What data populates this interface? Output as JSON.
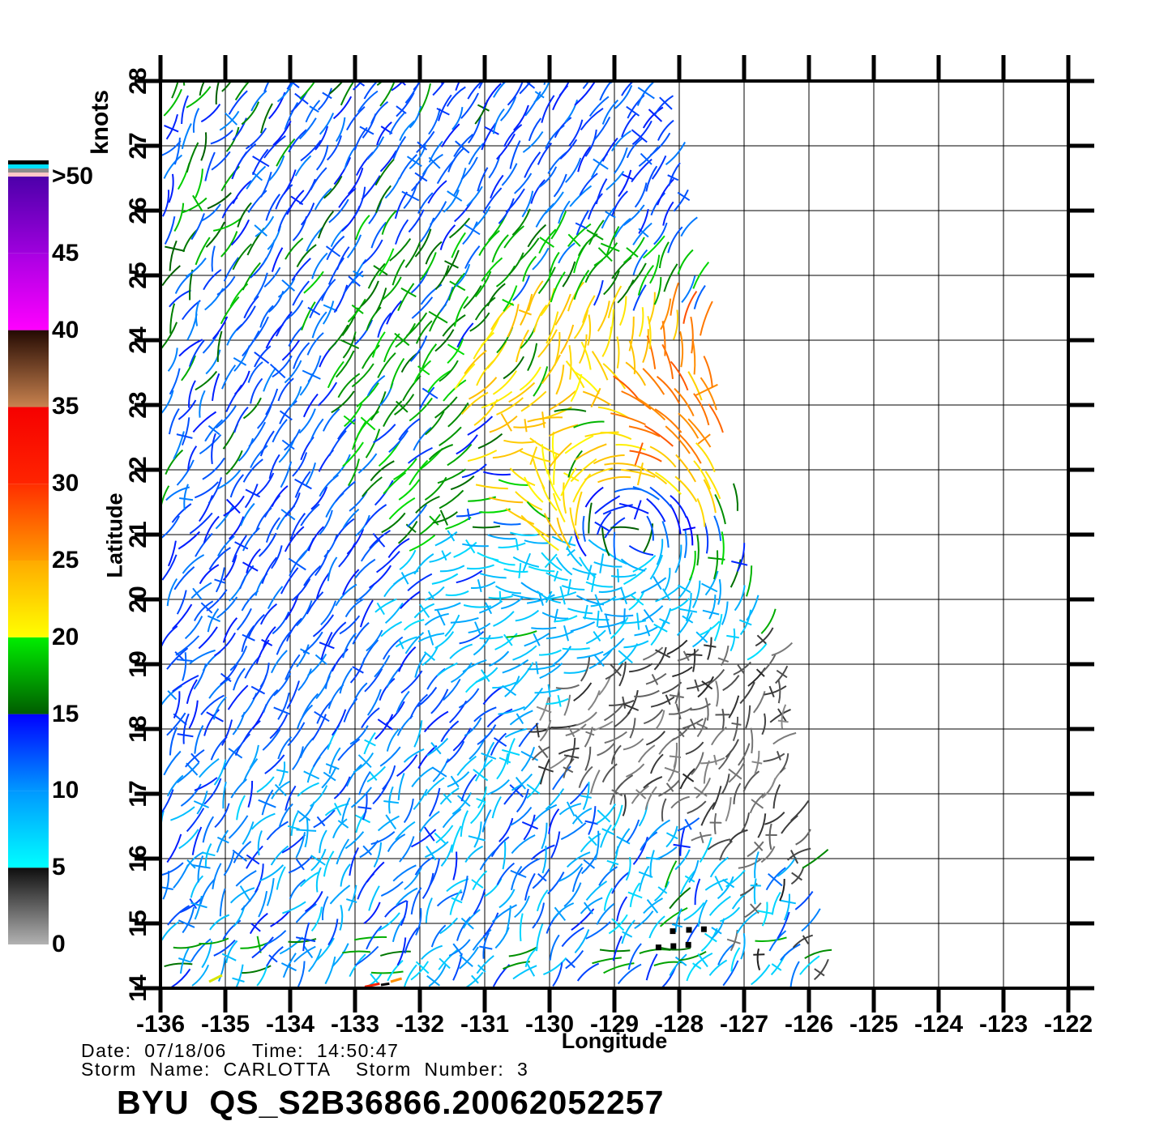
{
  "page": {
    "background": "#ffffff"
  },
  "colorbar": {
    "title": "knots",
    "tick_labels": [
      ">50",
      "45",
      "40",
      "35",
      "30",
      "25",
      "20",
      "15",
      "10",
      "5",
      "0"
    ],
    "tick_values": [
      50,
      45,
      40,
      35,
      30,
      25,
      20,
      15,
      10,
      5,
      0
    ],
    "top_stripes": [
      "#000000",
      "#00e0ff",
      "#8c8c8c",
      "#ffc8c8"
    ],
    "segments": [
      {
        "from": 0,
        "to": 5,
        "color_low": "#b2b2b2",
        "color_high": "#0e0e0e"
      },
      {
        "from": 5,
        "to": 10,
        "color_low": "#00ffff",
        "color_high": "#0098ff"
      },
      {
        "from": 10,
        "to": 15,
        "color_low": "#0098ff",
        "color_high": "#0000ff"
      },
      {
        "from": 15,
        "to": 20,
        "color_low": "#005c00",
        "color_high": "#00ee00"
      },
      {
        "from": 20,
        "to": 25,
        "color_low": "#ffff00",
        "color_high": "#ffaa00"
      },
      {
        "from": 25,
        "to": 30,
        "color_low": "#ff9c00",
        "color_high": "#ff2e00"
      },
      {
        "from": 30,
        "to": 35,
        "color_low": "#ff2400",
        "color_high": "#f60000"
      },
      {
        "from": 35,
        "to": 40,
        "color_low": "#c8824f",
        "color_high": "#240a02"
      },
      {
        "from": 40,
        "to": 45,
        "color_low": "#ff00ff",
        "color_high": "#a800e2"
      },
      {
        "from": 45,
        "to": 50,
        "color_low": "#9f00dd",
        "color_high": "#4c00aa"
      }
    ]
  },
  "axes": {
    "x_title": "Longitude",
    "y_title": "Latitude",
    "lon_min": -136,
    "lon_max": -122,
    "lat_min": 14,
    "lat_max": 28,
    "x_tick_labels": [
      "-136",
      "-135",
      "-134",
      "-133",
      "-132",
      "-131",
      "-130",
      "-129",
      "-128",
      "-127",
      "-126",
      "-125",
      "-124",
      "-123",
      "-122"
    ],
    "y_tick_labels": [
      "28",
      "27",
      "26",
      "25",
      "24",
      "23",
      "22",
      "21",
      "20",
      "19",
      "18",
      "17",
      "16",
      "15",
      "14"
    ]
  },
  "footer": {
    "date_line": "Date:  07/18/06    Time:  14:50:47",
    "storm_line": "Storm  Name:  CARLOTTA    Storm  Number:  3",
    "title": "BYU  QS_S2B36866.20062052257"
  },
  "chart_data": {
    "type": "wind_vector_map",
    "title": "BYU QS_S2B36866.20062052257",
    "units": "knots",
    "speed_scale_knots": [
      0,
      50
    ],
    "xlabel": "Longitude",
    "ylabel": "Latitude",
    "xlim": [
      -136,
      -122
    ],
    "ylim": [
      14,
      28
    ],
    "grid": true,
    "storm": {
      "name": "CARLOTTA",
      "number": 3,
      "date": "07/18/06",
      "time": "14:50:47",
      "center_lon": -128.7,
      "center_lat": 20.9,
      "rotation": "counterclockwise"
    },
    "background_flow_deg": 57,
    "lattice": {
      "spacing_px": 22,
      "row_angle_deg": 57,
      "seed": 7
    },
    "swath_boundary_lon_by_lat": [
      [
        28,
        -128.35
      ],
      [
        27,
        -128.1
      ],
      [
        26,
        -127.95
      ],
      [
        25,
        -127.75
      ],
      [
        24.3,
        -127.5
      ],
      [
        23,
        -127.35
      ],
      [
        22,
        -127.15
      ],
      [
        21,
        -127.05
      ],
      [
        20,
        -126.8
      ],
      [
        19.3,
        -126.4
      ],
      [
        18,
        -126.3
      ],
      [
        17,
        -126.2
      ],
      [
        16,
        -125.95
      ],
      [
        15,
        -125.9
      ],
      [
        14,
        -125.75
      ]
    ],
    "base_speed_range": [
      10.5,
      14.2
    ],
    "nw_green_mix": {
      "prob_max": 0.55,
      "speed": [
        15,
        19
      ]
    },
    "south_green_band": {
      "lat0": 14.2,
      "lat1": 14.8,
      "prob": 0.22,
      "speed": [
        15.5,
        18
      ],
      "dir_deg": 8
    },
    "speed_regions": [
      {
        "name": "green-ring",
        "shape": "ellipse",
        "cx": -129.5,
        "cy": 22.3,
        "rx": 4.3,
        "ry": 3.1,
        "rot": -30,
        "prob": 0.72,
        "speed": [
          15.5,
          19.5
        ]
      },
      {
        "name": "yellow-arc",
        "shape": "ellipse",
        "cx": -129.25,
        "cy": 22.55,
        "rx": 2.4,
        "ry": 1.9,
        "rot": -30,
        "prob": 0.92,
        "speed": [
          20.3,
          24
        ]
      },
      {
        "name": "orange-hotspot",
        "shape": "ellipse",
        "cx": -127.95,
        "cy": 23.25,
        "rx": 0.75,
        "ry": 1.25,
        "rot": 0,
        "prob": 0.85,
        "speed": [
          25.5,
          28.5
        ]
      },
      {
        "name": "storm-center-calm",
        "shape": "ellipse",
        "cx": -128.7,
        "cy": 20.9,
        "rx": 1.0,
        "ry": 0.95,
        "rot": 0,
        "prob": 1,
        "speed": [
          11,
          15.5
        ]
      },
      {
        "name": "cyan-west-band",
        "shape": "ellipse",
        "cx": -129.9,
        "cy": 19.5,
        "rx": 2.9,
        "ry": 1.5,
        "rot": -10,
        "prob": 0.95,
        "speed": [
          6.5,
          9.5
        ]
      },
      {
        "name": "cyan-ring",
        "shape": "ellipse",
        "cx": -127.8,
        "cy": 17.8,
        "rx": 3.0,
        "ry": 2.3,
        "rot": 0,
        "prob": 0.6,
        "speed": [
          6.5,
          9.8
        ]
      },
      {
        "name": "cyan-southwest",
        "shape": "ellipse",
        "cx": -132.9,
        "cy": 15.6,
        "rx": 3.9,
        "ry": 2.2,
        "rot": 0,
        "prob": 0.55,
        "speed": [
          7,
          10.5
        ]
      },
      {
        "name": "cyan-southeast",
        "shape": "ellipse",
        "cx": -127.3,
        "cy": 15.0,
        "rx": 1.9,
        "ry": 1.1,
        "rot": 0,
        "prob": 0.75,
        "speed": [
          6.5,
          9.5
        ]
      },
      {
        "name": "green-streak-south",
        "shape": "ellipse",
        "cx": -128.38,
        "cy": 14.9,
        "rx": 0.3,
        "ry": 0.85,
        "rot": 0,
        "prob": 0.5,
        "speed": [
          15.5,
          18
        ]
      },
      {
        "name": "green-streak-east",
        "shape": "ellipse",
        "cx": -126.02,
        "cy": 15.75,
        "rx": 0.16,
        "ry": 0.6,
        "rot": 0,
        "prob": 0.8,
        "speed": [
          15.5,
          18
        ]
      },
      {
        "name": "calm-blob-west",
        "shape": "ellipse",
        "cx": -128.5,
        "cy": 17.9,
        "rx": 1.8,
        "ry": 1.25,
        "rot": 0,
        "prob": 1,
        "speed": [
          1.2,
          4.2
        ],
        "fuzz": 0.45
      },
      {
        "name": "calm-blob-east",
        "shape": "ellipse",
        "cx": -126.95,
        "cy": 17.55,
        "rx": 1.5,
        "ry": 1.7,
        "rot": 0,
        "prob": 1,
        "speed": [
          1.2,
          4.2
        ],
        "fuzz": 0.45
      },
      {
        "name": "se-calm-scatter",
        "shape": "rect",
        "lon0": -127.3,
        "lon1": -125.7,
        "lat0": 14.1,
        "lat1": 16.4,
        "prob": 0.28,
        "speed": [
          1.5,
          4.5
        ]
      }
    ],
    "track_marks": {
      "dots": [
        [
          -128.32,
          14.63
        ],
        [
          -128.09,
          14.65
        ],
        [
          -127.86,
          14.67
        ],
        [
          -128.1,
          14.88
        ],
        [
          -127.85,
          14.9
        ],
        [
          -127.62,
          14.91
        ]
      ],
      "segments": [
        {
          "color": "#ff2000",
          "pts": [
            [
              -132.85,
              14.02
            ],
            [
              -132.62,
              14.07
            ]
          ]
        },
        {
          "color": "#000000",
          "pts": [
            [
              -132.6,
              14.05
            ],
            [
              -132.47,
              14.07
            ]
          ]
        },
        {
          "color": "#ff9000",
          "pts": [
            [
              -132.45,
              14.1
            ],
            [
              -132.28,
              14.15
            ]
          ]
        },
        {
          "color": "#d7e600",
          "pts": [
            [
              -135.25,
              14.1
            ],
            [
              -135.05,
              14.2
            ]
          ]
        }
      ]
    }
  }
}
